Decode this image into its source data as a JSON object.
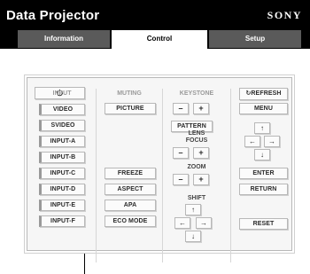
{
  "header": {
    "title": "Data Projector",
    "brand": "SONY"
  },
  "tabs": [
    {
      "label": "Information",
      "active": false
    },
    {
      "label": "Control",
      "active": true
    },
    {
      "label": "Setup",
      "active": false
    }
  ],
  "power": {
    "icon": "power-icon",
    "glyph": "⏻"
  },
  "refresh": {
    "label": "REFRESH",
    "glyph": "↻"
  },
  "input": {
    "heading": "INPUT",
    "items": [
      "VIDEO",
      "SVIDEO",
      "INPUT-A",
      "INPUT-B",
      "INPUT-C",
      "INPUT-D",
      "INPUT-E",
      "INPUT-F"
    ]
  },
  "muting": {
    "heading": "MUTING",
    "picture": "PICTURE"
  },
  "picture_adjust": {
    "freeze": "FREEZE",
    "aspect": "ASPECT",
    "apa": "APA",
    "eco_mode": "ECO MODE"
  },
  "keystone": {
    "heading": "KEYSTONE",
    "minus": "–",
    "plus": "+"
  },
  "pattern": "PATTERN",
  "lens": {
    "heading": "LENS",
    "focus_label": "FOCUS",
    "minus": "–",
    "plus": "+"
  },
  "zoom": {
    "heading": "ZOOM",
    "minus": "–",
    "plus": "+"
  },
  "shift": {
    "heading": "SHIFT",
    "up": "↑",
    "left": "←",
    "right": "→",
    "down": "↓"
  },
  "menu": {
    "menu_label": "MENU",
    "up": "↑",
    "left": "←",
    "right": "→",
    "down": "↓",
    "enter": "ENTER",
    "return": "RETURN",
    "reset": "RESET"
  }
}
